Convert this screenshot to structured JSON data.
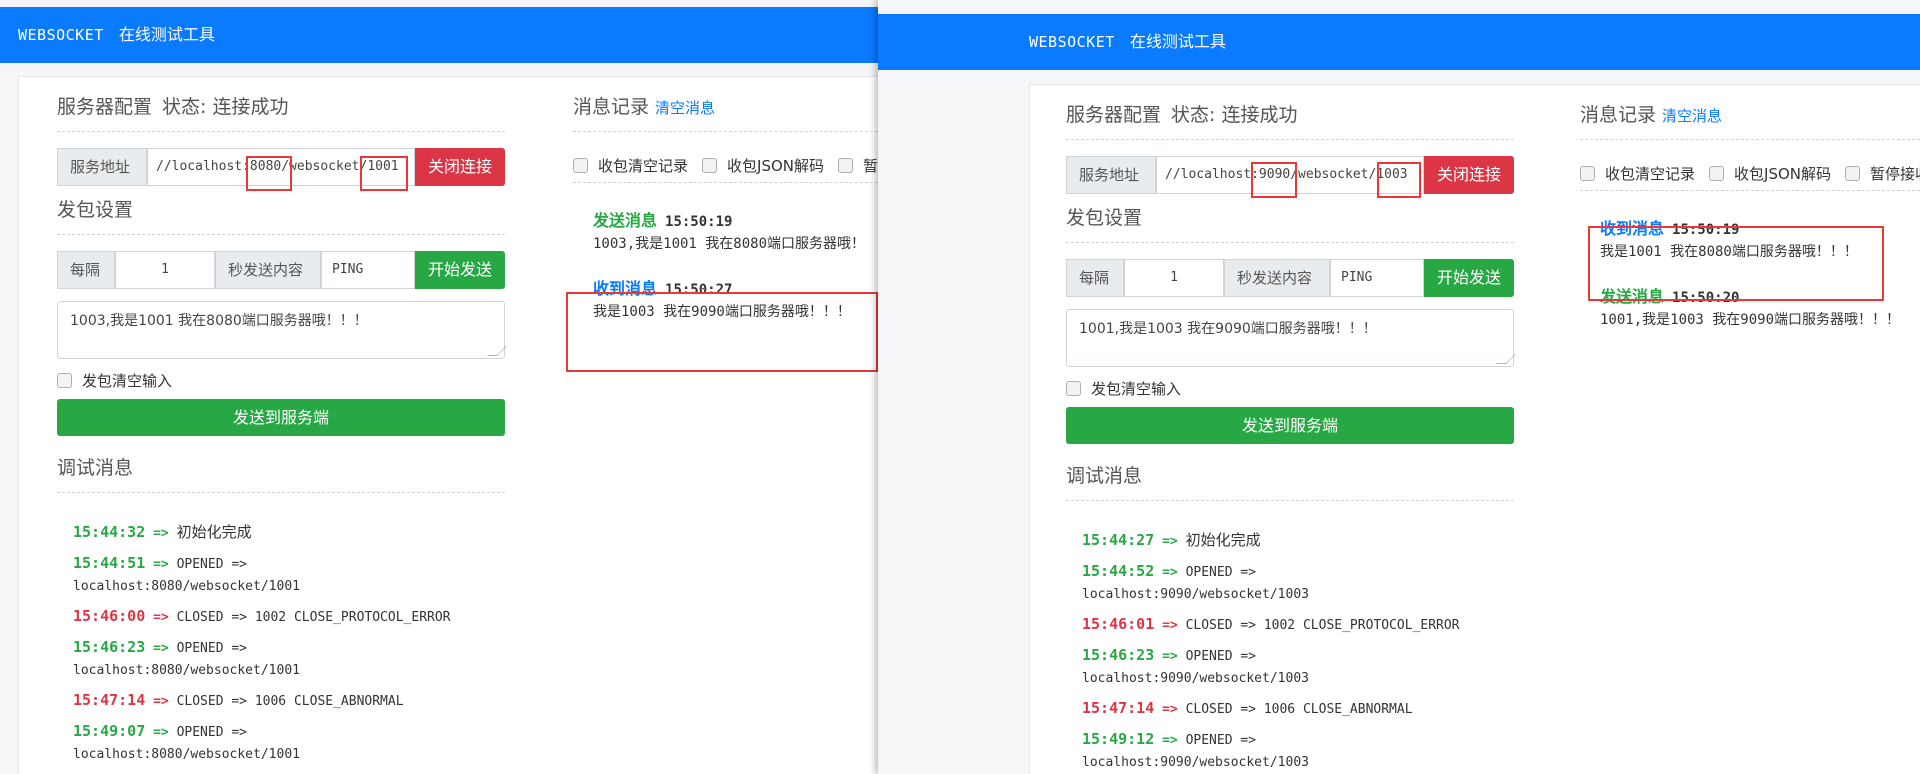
{
  "app": {
    "brand_en": "WEBSOCKET",
    "brand_cn": "在线测试工具"
  },
  "colors": {
    "accent": "#0a7bff",
    "danger": "#dc3545",
    "success": "#28a745",
    "highlight": "#e83838"
  },
  "left": {
    "server_title": "服务器配置",
    "status_text": "状态: 连接成功",
    "address_label": "服务地址",
    "address_value": "//localhost:8080/websocket/1001",
    "close_button": "关闭连接",
    "send_title": "发包设置",
    "every_label": "每隔",
    "interval": "1",
    "seconds_label": "秒发送内容",
    "ping_value": "PING",
    "start_button": "开始发送",
    "textarea": "1003,我是1001 我在8080端口服务器哦！！！",
    "clear_input_label": "发包清空输入",
    "send_button": "发送到服务端",
    "debug_title": "调试消息",
    "logs": [
      {
        "time": "15:44:32",
        "arrow": "=>",
        "text": "初始化完成",
        "color": "green"
      },
      {
        "time": "15:44:51",
        "arrow": "=>",
        "text": "OPENED =>",
        "url": "localhost:8080/websocket/1001",
        "color": "green"
      },
      {
        "time": "15:46:00",
        "arrow": "=>",
        "text": "CLOSED => 1002 CLOSE_PROTOCOL_ERROR",
        "color": "red"
      },
      {
        "time": "15:46:23",
        "arrow": "=>",
        "text": "OPENED =>",
        "url": "localhost:8080/websocket/1001",
        "color": "green"
      },
      {
        "time": "15:47:14",
        "arrow": "=>",
        "text": "CLOSED => 1006 CLOSE_ABNORMAL",
        "color": "red"
      },
      {
        "time": "15:49:07",
        "arrow": "=>",
        "text": "OPENED =>",
        "url": "localhost:8080/websocket/1001",
        "color": "green"
      }
    ],
    "msg_title": "消息记录",
    "clear_msgs": "清空消息",
    "opt1": "收包清空记录",
    "opt2": "收包JSON解码",
    "opt3": "暂停",
    "messages": [
      {
        "type": "发送消息",
        "time": "15:50:19",
        "body": "1003,我是1001 我在8080端口服务器哦！",
        "color": "green"
      },
      {
        "type": "收到消息",
        "time": "15:50:27",
        "body": "我是1003 我在9090端口服务器哦！！！",
        "color": "blue"
      }
    ]
  },
  "right": {
    "server_title": "服务器配置",
    "status_text": "状态: 连接成功",
    "address_label": "服务地址",
    "address_value": "//localhost:9090/websocket/1003",
    "close_button": "关闭连接",
    "send_title": "发包设置",
    "every_label": "每隔",
    "interval": "1",
    "seconds_label": "秒发送内容",
    "ping_value": "PING",
    "start_button": "开始发送",
    "textarea": "1001,我是1003 我在9090端口服务器哦！！！",
    "clear_input_label": "发包清空输入",
    "send_button": "发送到服务端",
    "debug_title": "调试消息",
    "logs": [
      {
        "time": "15:44:27",
        "arrow": "=>",
        "text": "初始化完成",
        "color": "green"
      },
      {
        "time": "15:44:52",
        "arrow": "=>",
        "text": "OPENED =>",
        "url": "localhost:9090/websocket/1003",
        "color": "green"
      },
      {
        "time": "15:46:01",
        "arrow": "=>",
        "text": "CLOSED => 1002 CLOSE_PROTOCOL_ERROR",
        "color": "red"
      },
      {
        "time": "15:46:23",
        "arrow": "=>",
        "text": "OPENED =>",
        "url": "localhost:9090/websocket/1003",
        "color": "green"
      },
      {
        "time": "15:47:14",
        "arrow": "=>",
        "text": "CLOSED => 1006 CLOSE_ABNORMAL",
        "color": "red"
      },
      {
        "time": "15:49:12",
        "arrow": "=>",
        "text": "OPENED =>",
        "url": "localhost:9090/websocket/1003",
        "color": "green"
      }
    ],
    "msg_title": "消息记录",
    "clear_msgs": "清空消息",
    "opt1": "收包清空记录",
    "opt2": "收包JSON解码",
    "opt3": "暂停接收",
    "messages": [
      {
        "type": "收到消息",
        "time": "15:50:19",
        "body": "我是1001 我在8080端口服务器哦！！！",
        "color": "blue"
      },
      {
        "type": "发送消息",
        "time": "15:50:20",
        "body": "1001,我是1003 我在9090端口服务器哦！！！",
        "color": "green"
      }
    ]
  }
}
